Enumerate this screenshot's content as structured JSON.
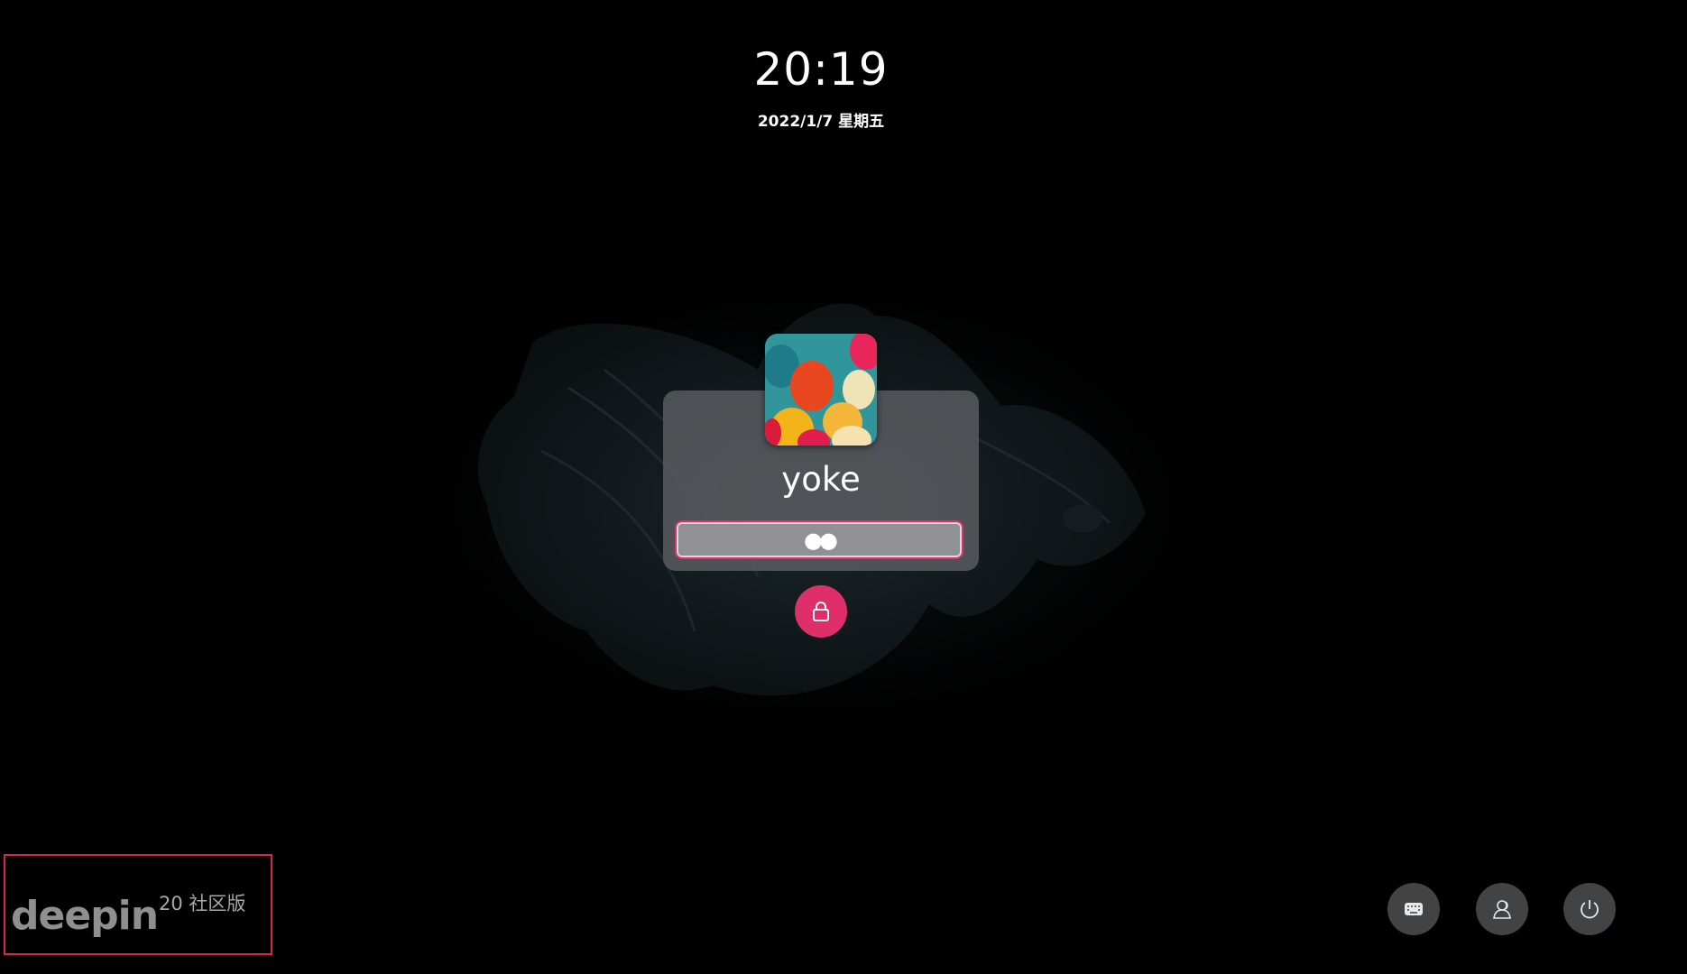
{
  "clock": {
    "time": "20:19",
    "date": "2022/1/7 星期五"
  },
  "user": {
    "name": "yoke",
    "avatar_icon": "balloons-avatar"
  },
  "password": {
    "masked_value": "●●"
  },
  "unlock_button": {
    "icon": "lock-icon"
  },
  "branding": {
    "logo_text": "deepin",
    "edition": "20 社区版"
  },
  "tray": {
    "keyboard_icon": "keyboard-icon",
    "switch_user_icon": "users-icon",
    "power_icon": "power-icon"
  },
  "colors": {
    "accent": "#df2f6b",
    "highlight_border": "#d6264a",
    "card": "#5c5e61"
  }
}
